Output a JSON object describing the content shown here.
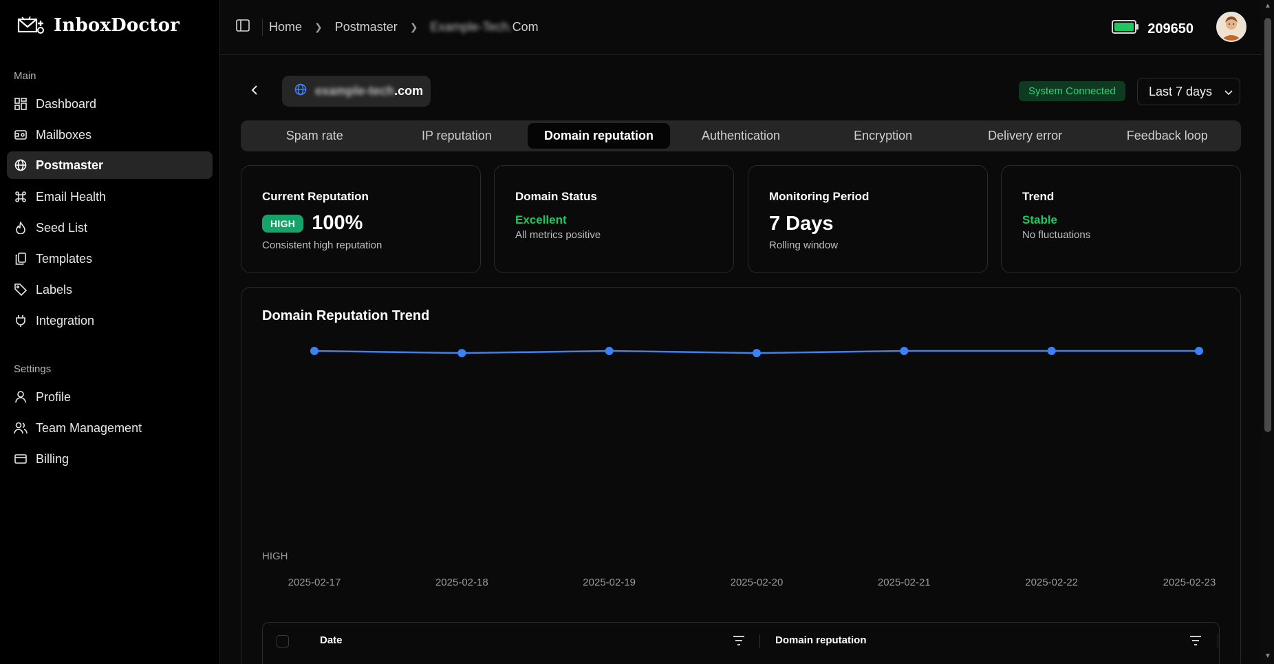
{
  "brand": {
    "name": "InboxDoctor"
  },
  "sidebar": {
    "main_label": "Main",
    "settings_label": "Settings",
    "main_items": [
      {
        "label": "Dashboard",
        "icon": "dashboard-icon"
      },
      {
        "label": "Mailboxes",
        "icon": "mailbox-icon"
      },
      {
        "label": "Postmaster",
        "icon": "globe-icon",
        "active": true
      },
      {
        "label": "Email Health",
        "icon": "command-icon"
      },
      {
        "label": "Seed List",
        "icon": "flame-icon"
      },
      {
        "label": "Templates",
        "icon": "copy-icon"
      },
      {
        "label": "Labels",
        "icon": "tag-icon"
      },
      {
        "label": "Integration",
        "icon": "plug-icon"
      }
    ],
    "settings_items": [
      {
        "label": "Profile",
        "icon": "user-icon"
      },
      {
        "label": "Team Management",
        "icon": "users-icon"
      },
      {
        "label": "Billing",
        "icon": "credit-card-icon"
      }
    ]
  },
  "header": {
    "breadcrumbs": {
      "home": "Home",
      "postmaster": "Postmaster",
      "domain_blurred": "Example-Tech.",
      "domain_suffix": "Com"
    },
    "credits": "209650"
  },
  "domain": {
    "blurred": "example-tech",
    "suffix": ".com"
  },
  "status": {
    "label": "System Connected"
  },
  "range": {
    "selected": "Last 7 days"
  },
  "tabs": [
    {
      "label": "Spam rate"
    },
    {
      "label": "IP reputation"
    },
    {
      "label": "Domain reputation",
      "active": true
    },
    {
      "label": "Authentication"
    },
    {
      "label": "Encryption"
    },
    {
      "label": "Delivery error"
    },
    {
      "label": "Feedback loop"
    }
  ],
  "cards": {
    "current_reputation": {
      "title": "Current Reputation",
      "badge": "HIGH",
      "value": "100%",
      "sub": "Consistent high reputation"
    },
    "domain_status": {
      "title": "Domain Status",
      "status": "Excellent",
      "sub": "All metrics positive"
    },
    "monitoring_period": {
      "title": "Monitoring Period",
      "value": "7 Days",
      "sub": "Rolling window"
    },
    "trend": {
      "title": "Trend",
      "status": "Stable",
      "sub": "No fluctuations"
    }
  },
  "chart_title": "Domain Reputation Trend",
  "chart_data": {
    "type": "line",
    "title": "Domain Reputation Trend",
    "x": [
      "2025-02-17",
      "2025-02-18",
      "2025-02-19",
      "2025-02-20",
      "2025-02-21",
      "2025-02-22",
      "2025-02-23"
    ],
    "y_tick": "HIGH",
    "values": [
      100,
      99.6,
      100,
      99.6,
      100,
      100,
      100
    ],
    "color": "#3b82f6"
  },
  "table": {
    "col_date": "Date",
    "col_reputation": "Domain reputation"
  }
}
